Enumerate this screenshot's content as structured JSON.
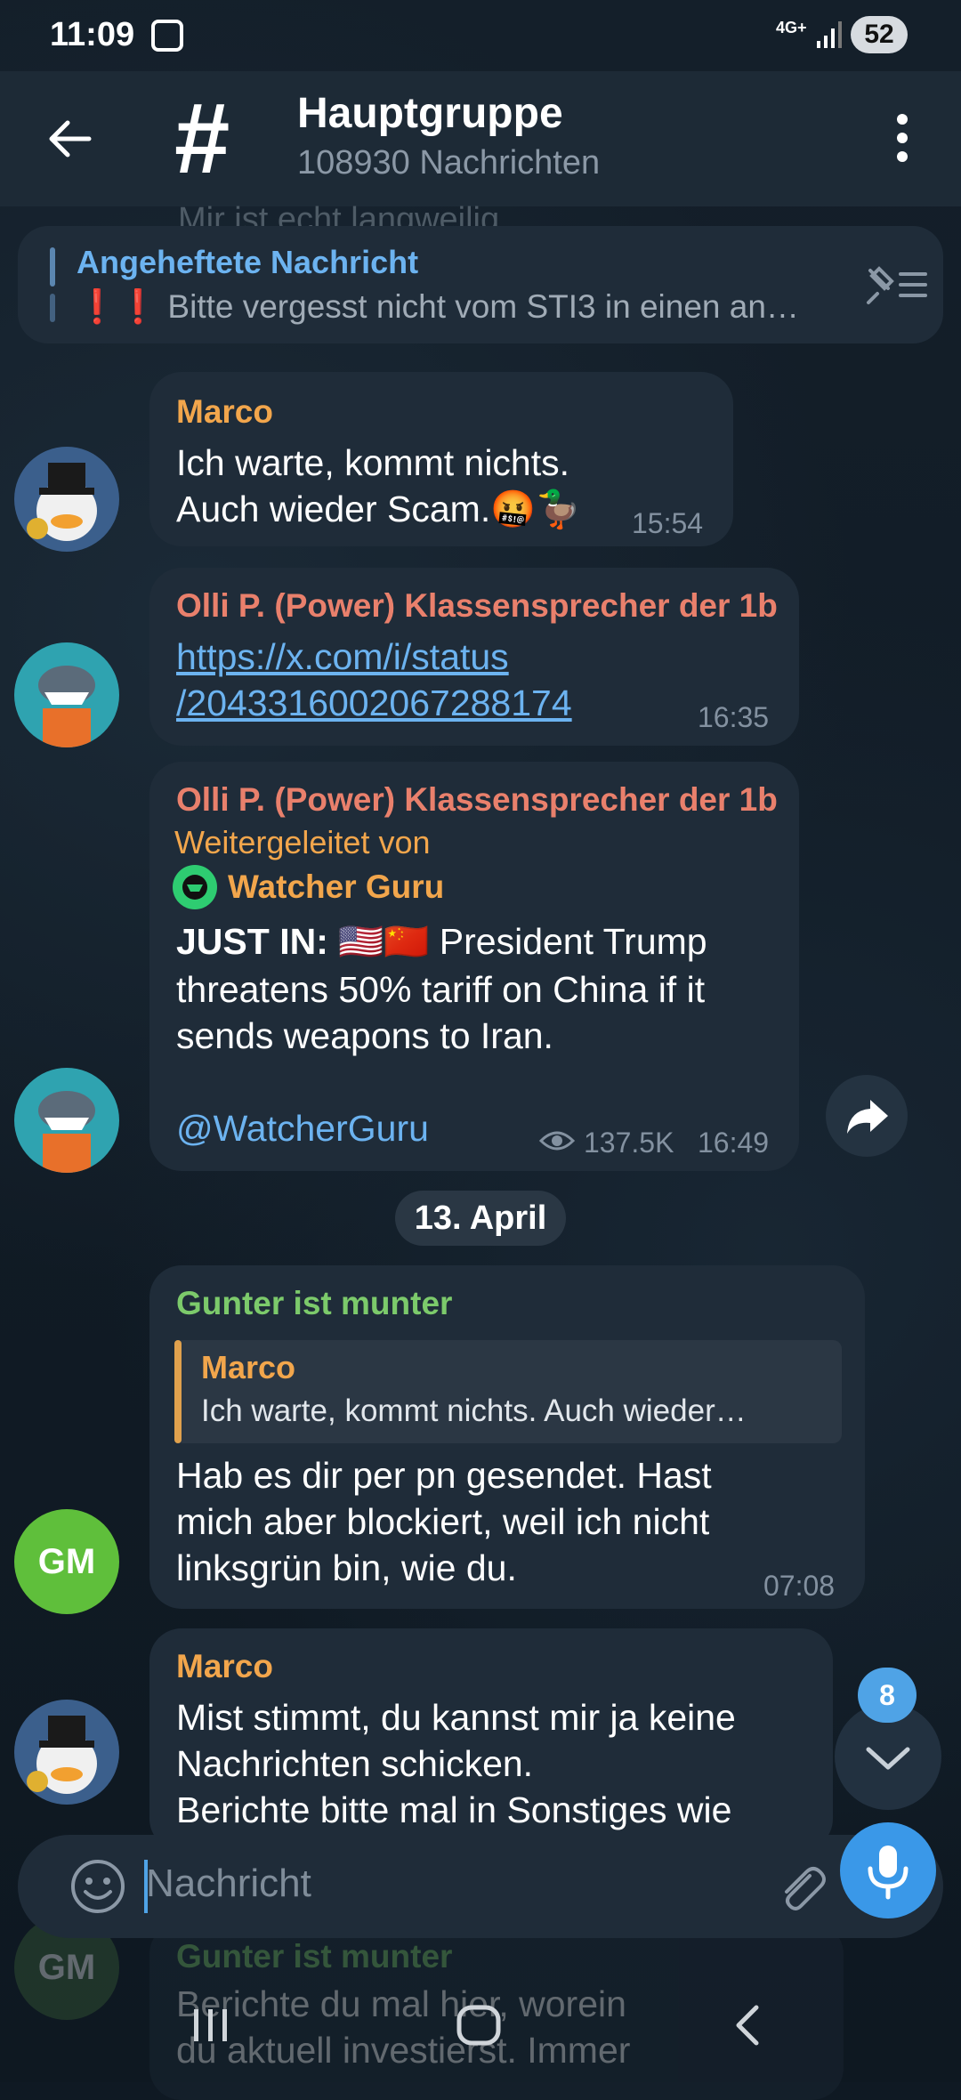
{
  "status": {
    "time": "11:09",
    "network": "4G+",
    "battery": "52"
  },
  "header": {
    "title": "Hauptgruppe",
    "subtitle": "108930 Nachrichten"
  },
  "ghost_line": "Mir ist echt langweilig",
  "pinned": {
    "title": "Angeheftete Nachricht",
    "text": "❗️❗️ Bitte vergesst nicht vom STI3 in einen an…"
  },
  "messages": [
    {
      "sender": "Marco",
      "lines": [
        "Ich warte, kommt nichts.",
        "Auch wieder Scam.🤬🦆"
      ],
      "time": "15:54"
    },
    {
      "sender": "Olli P. (Power) Klassensprecher der 1b",
      "link_lines": [
        "https://x.com/i/status",
        "/2043316002067288174"
      ],
      "time": "16:35"
    },
    {
      "sender": "Olli P. (Power) Klassensprecher der 1b",
      "forwarded_label": "Weitergeleitet von",
      "forwarded_from": "Watcher Guru",
      "bold": "JUST IN:",
      "flags": "🇺🇸🇨🇳",
      "lines": [
        "President Trump",
        "threatens 50% tariff on China if it",
        "sends weapons to Iran."
      ],
      "handle": "@WatcherGuru",
      "views": "137.5K",
      "time": "16:49"
    },
    {
      "sender": "Gunter ist munter",
      "reply_name": "Marco",
      "reply_text": "Ich warte, kommt nichts. Auch wieder…",
      "lines": [
        "Hab es dir per pn gesendet. Hast",
        "mich aber blockiert, weil ich nicht",
        "linksgrün bin, wie du."
      ],
      "time": "07:08",
      "avatar": "GM"
    },
    {
      "sender": "Marco",
      "lines": [
        "Mist stimmt, du kannst mir ja keine",
        "Nachrichten schicken.",
        "Berichte bitte mal in Sonstiges wie"
      ]
    },
    {
      "sender": "Gunter ist munter",
      "lines": [
        "Berichte du mal hier, worein",
        "du aktuell investierst. Immer"
      ],
      "avatar": "GM"
    }
  ],
  "date_chip": "13. April",
  "unread_badge": "8",
  "composer": {
    "placeholder": "Nachricht"
  },
  "colors": {
    "accent": "#4fa3e6",
    "bubble": "#1f2c39",
    "marco": "#f2a64c",
    "olli": "#e9806c",
    "gunter": "#7cca6b"
  }
}
